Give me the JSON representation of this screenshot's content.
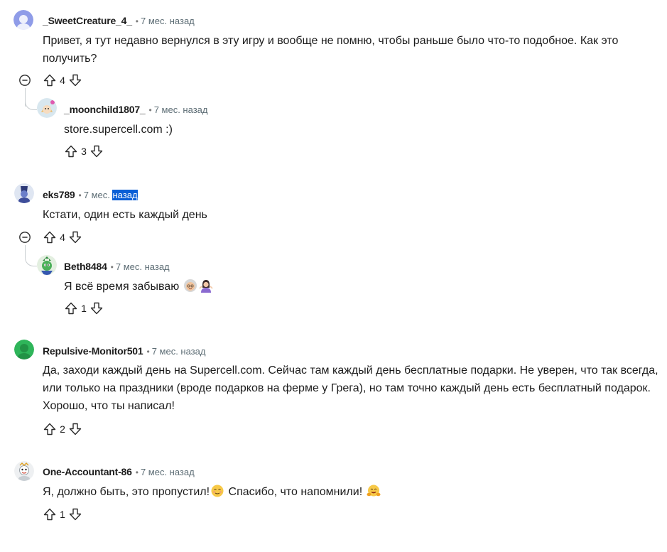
{
  "vote_labels": {
    "up": "upvote",
    "down": "downvote"
  },
  "comments": [
    {
      "author": "_SweetCreature_4_",
      "separator": "•",
      "time": "7 мес. назад",
      "text": "Привет, я тут недавно вернулся в эту игру и вообще не помню, чтобы раньше было что-то подобное. Как это получить?",
      "votes": "4",
      "avatar_color": "#8090e0",
      "reply": {
        "author": "_moonchild1807_",
        "separator": "•",
        "time": "7 мес. назад",
        "text": "store.supercell.com :)",
        "votes": "3"
      }
    },
    {
      "author": "eks789",
      "separator": "•",
      "time_prefix": "7 мес.",
      "time_highlight": "назад",
      "text": "Кстати, один есть каждый день",
      "votes": "4",
      "reply": {
        "author": "Beth8484",
        "separator": "•",
        "time": "7 мес. назад",
        "text": "Я всё время забываю",
        "votes": "1"
      }
    },
    {
      "author": "Repulsive-Monitor501",
      "separator": "•",
      "time": "7 мес. назад",
      "text": "Да, заходи каждый день на Supercell.com. Сейчас там каждый день бесплатные подарки. Не уверен, что так всегда, или только на праздники (вроде подарков на ферме у Грега), но там точно каждый день есть бесплатный подарок. Хорошо, что ты написал!",
      "votes": "2",
      "avatar_color": "#2fb55a"
    },
    {
      "author": "One-Accountant-86",
      "separator": "•",
      "time": "7 мес. назад",
      "text_before": "Я, должно быть, это пропустил!",
      "text_after": " Спасибо, что напомнили! ",
      "votes": "1"
    }
  ]
}
